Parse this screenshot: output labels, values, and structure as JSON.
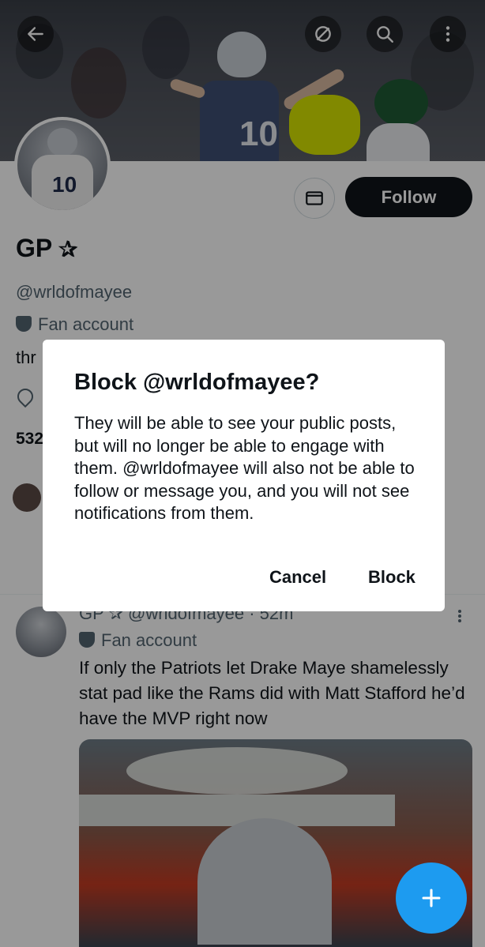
{
  "header": {
    "back_icon": "arrow-left-icon",
    "grok_icon": "slash-circle-icon",
    "search_icon": "search-icon",
    "more_icon": "more-vertical-icon"
  },
  "profile": {
    "name": "GP",
    "handle": "@wrldofmayee",
    "label": "Fan account",
    "bio_partial": "thr",
    "stat_partial": "532",
    "follow_label": "Follow"
  },
  "dialog": {
    "title": "Block @wrldofmayee?",
    "body": "They will be able to see your public posts, but will no longer be able to engage with them. @wrldofmayee will also not be able to follow or message you, and you will not see notifications from them.",
    "cancel_label": "Cancel",
    "block_label": "Block"
  },
  "post": {
    "header_partial": "GP ✰ @wrldofmayee · 52m",
    "label": "Fan account",
    "text": "If only the Patriots let Drake Maye shamelessly stat pad like the Rams did with Matt Stafford he’d have the MVP right now"
  },
  "colors": {
    "accent": "#1d9bf0",
    "follow_bg": "#0f1419",
    "overlay": "rgba(0,0,0,0.40)"
  }
}
